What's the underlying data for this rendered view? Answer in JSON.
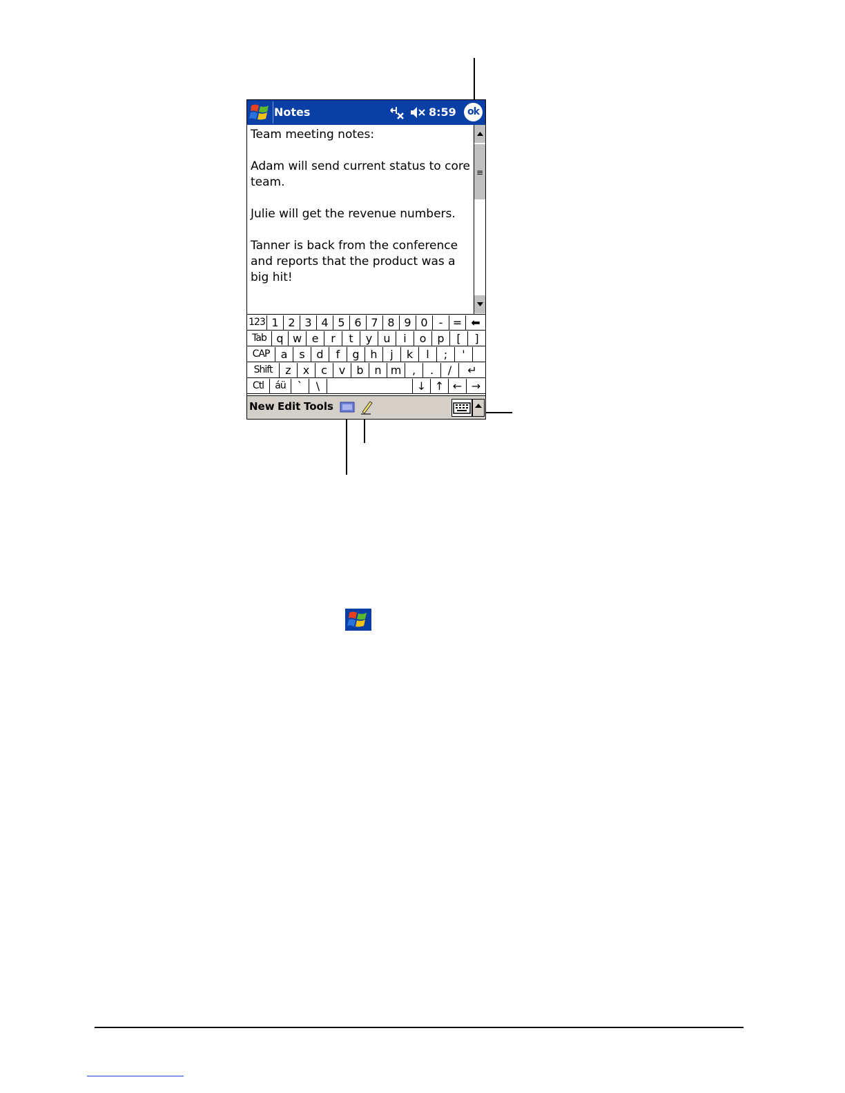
{
  "titlebar": {
    "app_title": "Notes",
    "clock": "8:59",
    "ok_label": "ok",
    "start_icon": "windows-flag-icon",
    "connectivity_icon": "connectivity-icon",
    "volume_icon": "speaker-muted-icon",
    "color": "#0a3fa6"
  },
  "note": {
    "lines": [
      "Team meeting notes:",
      "",
      "Adam will send current status to core",
      "team.",
      "",
      "Julie will get the revenue numbers.",
      "",
      "Tanner is back from the conference",
      "and reports that the product was a",
      "big hit!"
    ]
  },
  "keyboard": {
    "rows": [
      [
        "123",
        "1",
        "2",
        "3",
        "4",
        "5",
        "6",
        "7",
        "8",
        "9",
        "0",
        "-",
        "=",
        "⬅"
      ],
      [
        "Tab",
        "q",
        "w",
        "e",
        "r",
        "t",
        "y",
        "u",
        "i",
        "o",
        "p",
        "[",
        "]"
      ],
      [
        "CAP",
        "a",
        "s",
        "d",
        "f",
        "g",
        "h",
        "j",
        "k",
        "l",
        ";",
        "'"
      ],
      [
        "Shift",
        "z",
        "x",
        "c",
        "v",
        "b",
        "n",
        "m",
        ",",
        ".",
        "/",
        "↵"
      ],
      [
        "Ctl",
        "áü",
        "`",
        "\\",
        "",
        "↓",
        "↑",
        "←",
        "→"
      ]
    ]
  },
  "menubar": {
    "items": [
      "New",
      "Edit",
      "Tools"
    ],
    "input_panel_icon": "input-panel-icon",
    "pen_icon": "pen-icon",
    "keyboard_icon": "keyboard-icon",
    "sip_arrow_icon": "up-arrow-icon"
  },
  "page_icon": "windows-flag-icon"
}
